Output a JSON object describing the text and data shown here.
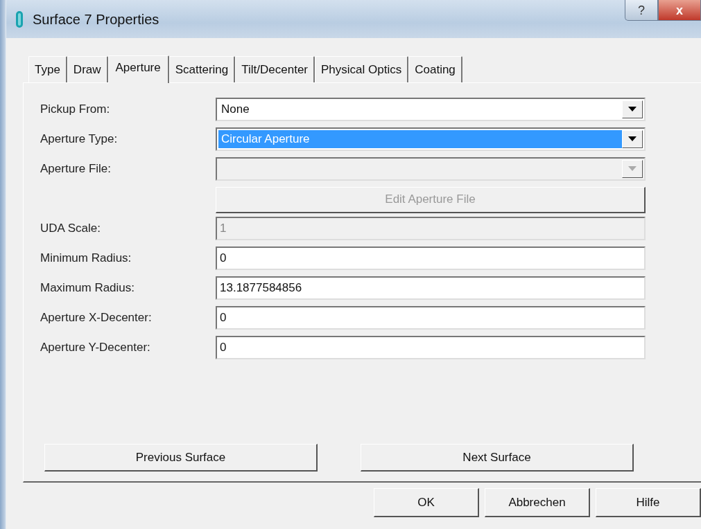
{
  "window": {
    "title": "Surface 7 Properties"
  },
  "title_buttons": [
    "?",
    "x"
  ],
  "tabs": [
    {
      "label": "Type",
      "selected": false
    },
    {
      "label": "Draw",
      "selected": false
    },
    {
      "label": "Aperture",
      "selected": true
    },
    {
      "label": "Scattering",
      "selected": false
    },
    {
      "label": "Tilt/Decenter",
      "selected": false
    },
    {
      "label": "Physical Optics",
      "selected": false
    },
    {
      "label": "Coating",
      "selected": false
    }
  ],
  "rows": [
    {
      "kind": "combo",
      "label": "Pickup From:",
      "value": "None",
      "highlighted": false,
      "disabled": false
    },
    {
      "kind": "combo",
      "label": "Aperture Type:",
      "value": "Circular Aperture",
      "highlighted": true,
      "disabled": false
    },
    {
      "kind": "combo",
      "label": "Aperture File:",
      "disabled": true,
      "highlighted": false
    },
    {
      "kind": "button",
      "label": "Edit Aperture File",
      "disabled": true
    },
    {
      "kind": "text",
      "label": "UDA Scale:",
      "value": "1",
      "disabled": true
    },
    {
      "kind": "text",
      "label": "Minimum Radius:",
      "value": "0",
      "disabled": false
    },
    {
      "kind": "text",
      "label": "Maximum Radius:",
      "value": "13.1877584856",
      "disabled": false
    },
    {
      "kind": "text",
      "label": "Aperture X-Decenter:",
      "value": "0",
      "disabled": false
    },
    {
      "kind": "text",
      "label": "Aperture Y-Decenter:",
      "value": "0",
      "disabled": false
    }
  ],
  "nav_buttons": [
    "Previous Surface",
    "Next Surface"
  ],
  "buttons": [
    "OK",
    "Abbrechen",
    "Hilfe"
  ]
}
